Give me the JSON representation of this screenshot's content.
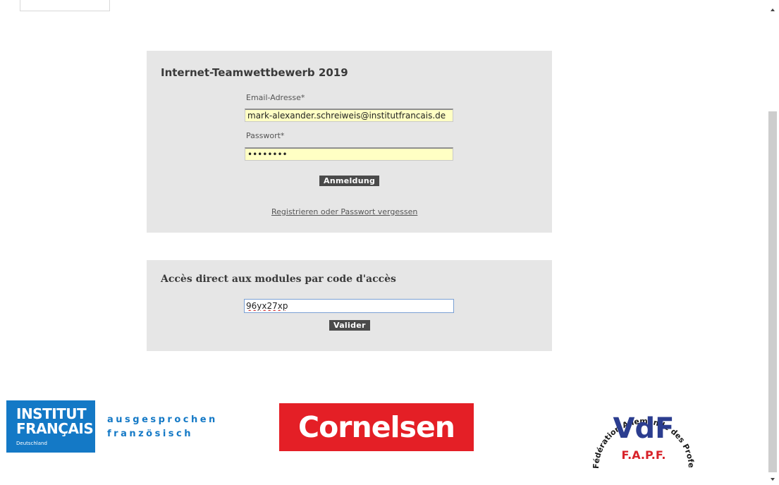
{
  "login_panel": {
    "title": "Internet-Teamwettbewerb 2019",
    "email_label": "Email-Adresse*",
    "email_value": "mark-alexander.schreiweis@institutfrancais.de",
    "password_label": "Passwort*",
    "password_value": "••••••••",
    "login_button": "Anmeldung",
    "register_link": "Registrieren oder Passwort vergessen"
  },
  "code_panel": {
    "title": "Accès direct aux modules par code d'accès",
    "code_value": "96yx27xp",
    "validate_button": "Valider"
  },
  "logos": {
    "institut_line1": "INSTITUT",
    "institut_line2": "FRANÇAIS",
    "institut_sub": "Deutschland",
    "tagline_line1": "ausgesprochen",
    "tagline_line2": "französisch",
    "cornelsen": "Cornelsen",
    "vdf_arc": "Fédération Allemande des Professeurs de Français",
    "vdf_main": "VdF",
    "vdf_sub": "F.A.P.F."
  },
  "colors": {
    "panel_bg": "#e6e6e6",
    "input_bg": "#ffffc4",
    "button_bg": "#4a4a4a",
    "institut_blue": "#1479c6",
    "cornelsen_red": "#e41f26",
    "vdf_blue": "#2b3d8f",
    "vdf_red": "#d8232a"
  }
}
